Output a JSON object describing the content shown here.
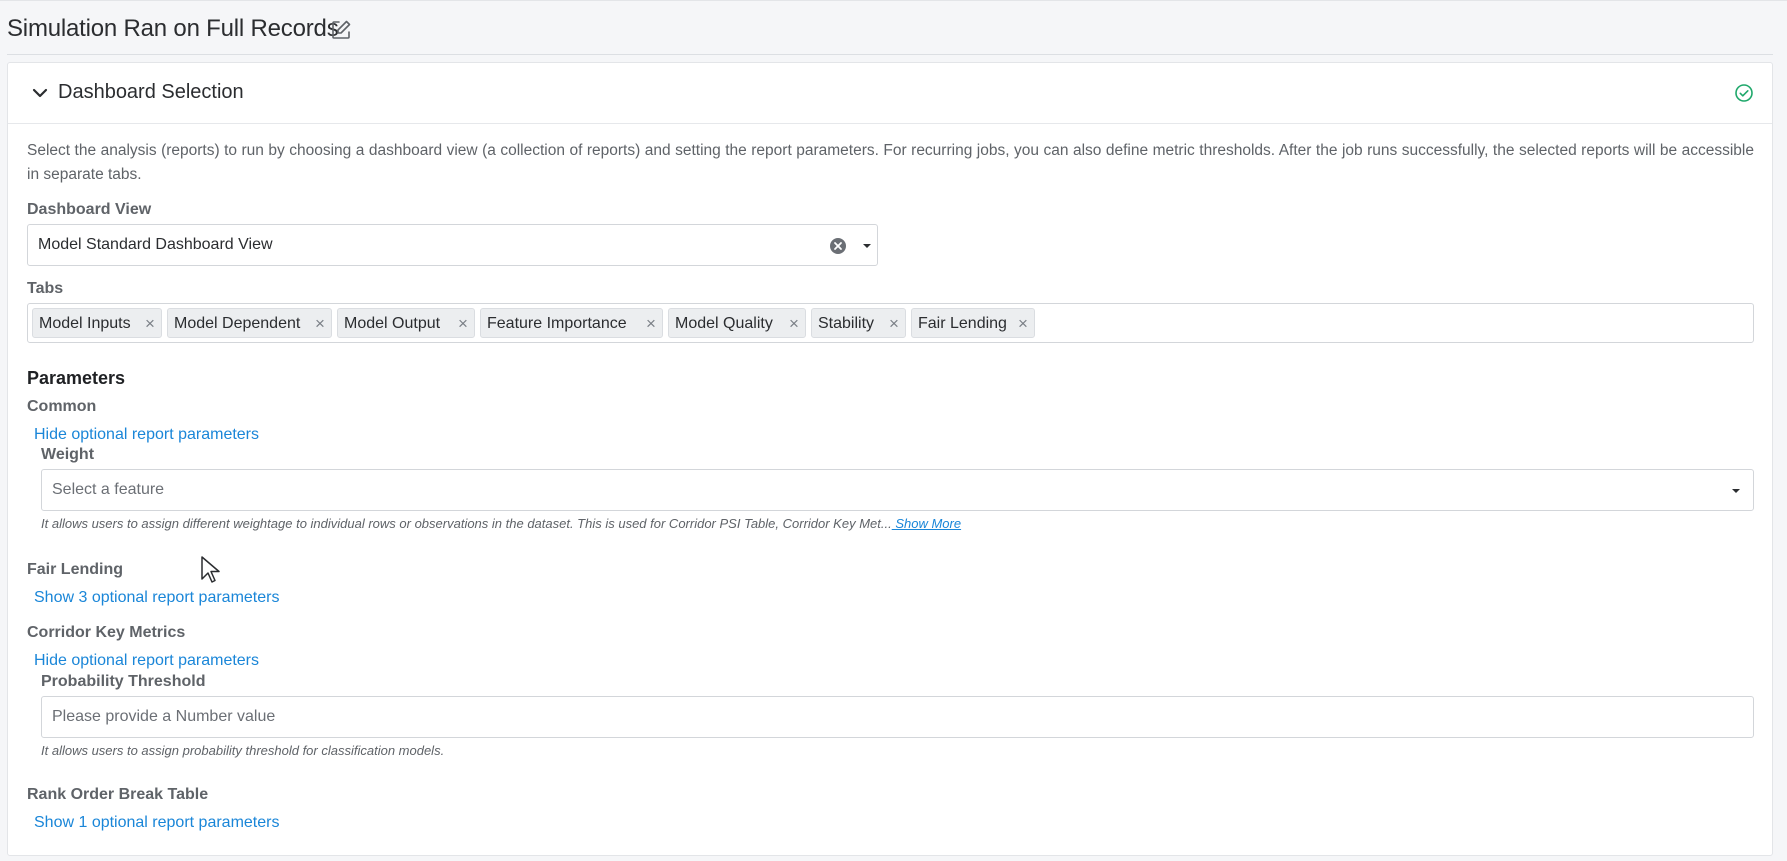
{
  "page": {
    "title": "Simulation Ran on Full Records"
  },
  "card": {
    "title": "Dashboard Selection",
    "description": "Select the analysis (reports) to run by choosing a dashboard view (a collection of reports) and setting the report parameters. For recurring jobs, you can also define metric thresholds. After the job runs successfully, the selected reports will be accessible in separate tabs."
  },
  "dashboard_view": {
    "label": "Dashboard View",
    "value": "Model Standard Dashboard View"
  },
  "tabs": {
    "label": "Tabs",
    "items": [
      "Model Inputs",
      "Model Dependent",
      "Model Output",
      "Feature Importance",
      "Model Quality",
      "Stability",
      "Fair Lending"
    ],
    "remove_glyph": "×"
  },
  "parameters": {
    "heading": "Parameters",
    "common": {
      "label": "Common",
      "toggle_link": "Hide optional report parameters",
      "weight": {
        "label": "Weight",
        "placeholder": "Select a feature",
        "help": "It allows users to assign different weightage to individual rows or observations in the dataset. This is used for Corridor PSI Table, Corridor Key Met...",
        "show_more": " Show More"
      }
    },
    "fair_lending": {
      "label": "Fair Lending",
      "toggle_link": "Show 3 optional report parameters"
    },
    "corridor_key_metrics": {
      "label": "Corridor Key Metrics",
      "toggle_link": "Hide optional report parameters",
      "probability_threshold": {
        "label": "Probability Threshold",
        "placeholder": "Please provide a Number value",
        "help": "It allows users to assign probability threshold for classification models."
      }
    },
    "rank_order_break_table": {
      "label": "Rank Order Break Table",
      "toggle_link": "Show 1 optional report parameters"
    }
  },
  "colors": {
    "link": "#1a86d8",
    "success": "#1fa86b",
    "tag_bg": "#eceef0"
  },
  "icons": [
    "edit-icon",
    "chevron-down-icon",
    "check-circle-icon",
    "clear-icon",
    "caret-down-icon",
    "mouse-cursor-icon"
  ]
}
